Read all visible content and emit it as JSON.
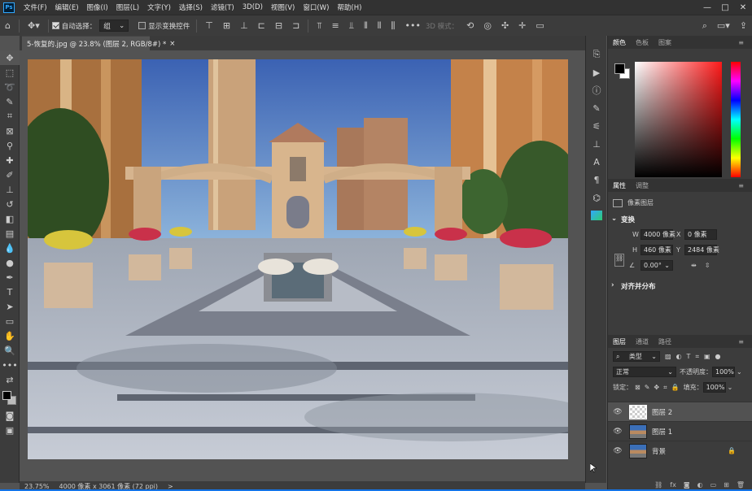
{
  "menubar": {
    "logo": "Ps",
    "items": [
      "文件(F)",
      "编辑(E)",
      "图像(I)",
      "图层(L)",
      "文字(Y)",
      "选择(S)",
      "滤镜(T)",
      "3D(D)",
      "视图(V)",
      "窗口(W)",
      "帮助(H)"
    ],
    "window_controls": [
      "—",
      "□",
      "✕"
    ]
  },
  "options": {
    "auto_select_label": "自动选择：",
    "auto_select_value": "组",
    "show_transform_label": "显示变换控件",
    "mode_3d_label": "3D 模式："
  },
  "document": {
    "tab_title": "5-恢复的.jpg @ 23.8% (图层 2, RGB/8#) *",
    "tab_close": "×"
  },
  "status": {
    "zoom": "23.75%",
    "doc_info": "4000 像素 x 3061 像素 (72 ppi)",
    "arrow": ">"
  },
  "color_panel": {
    "tabs": [
      "颜色",
      "色板",
      "图案"
    ],
    "colors": {
      "foreground": "#000000",
      "background": "#ffffff",
      "hue": "#ff1a1a"
    }
  },
  "properties_panel": {
    "tabs": [
      "属性",
      "调整"
    ],
    "layer_type": "像素图层",
    "transform_title": "变换",
    "w_label": "W",
    "w_value": "4000 像素",
    "x_label": "X",
    "x_value": "0 像素",
    "h_label": "H",
    "h_value": "460 像素",
    "y_label": "Y",
    "y_value": "2484 像素",
    "angle_value": "0.00°",
    "align_title": "对齐并分布"
  },
  "layers_panel": {
    "tabs": [
      "图层",
      "通道",
      "路径"
    ],
    "filter_kind": "类型",
    "blend_mode": "正常",
    "opacity_label": "不透明度：",
    "opacity_value": "100%",
    "lock_label": "锁定：",
    "fill_label": "填充：",
    "fill_value": "100%",
    "layers": [
      {
        "name": "图层 2",
        "selected": true,
        "thumb": "transparent"
      },
      {
        "name": "图层 1",
        "selected": false,
        "thumb": "image"
      },
      {
        "name": "背景",
        "selected": false,
        "thumb": "image",
        "locked": true
      }
    ]
  }
}
